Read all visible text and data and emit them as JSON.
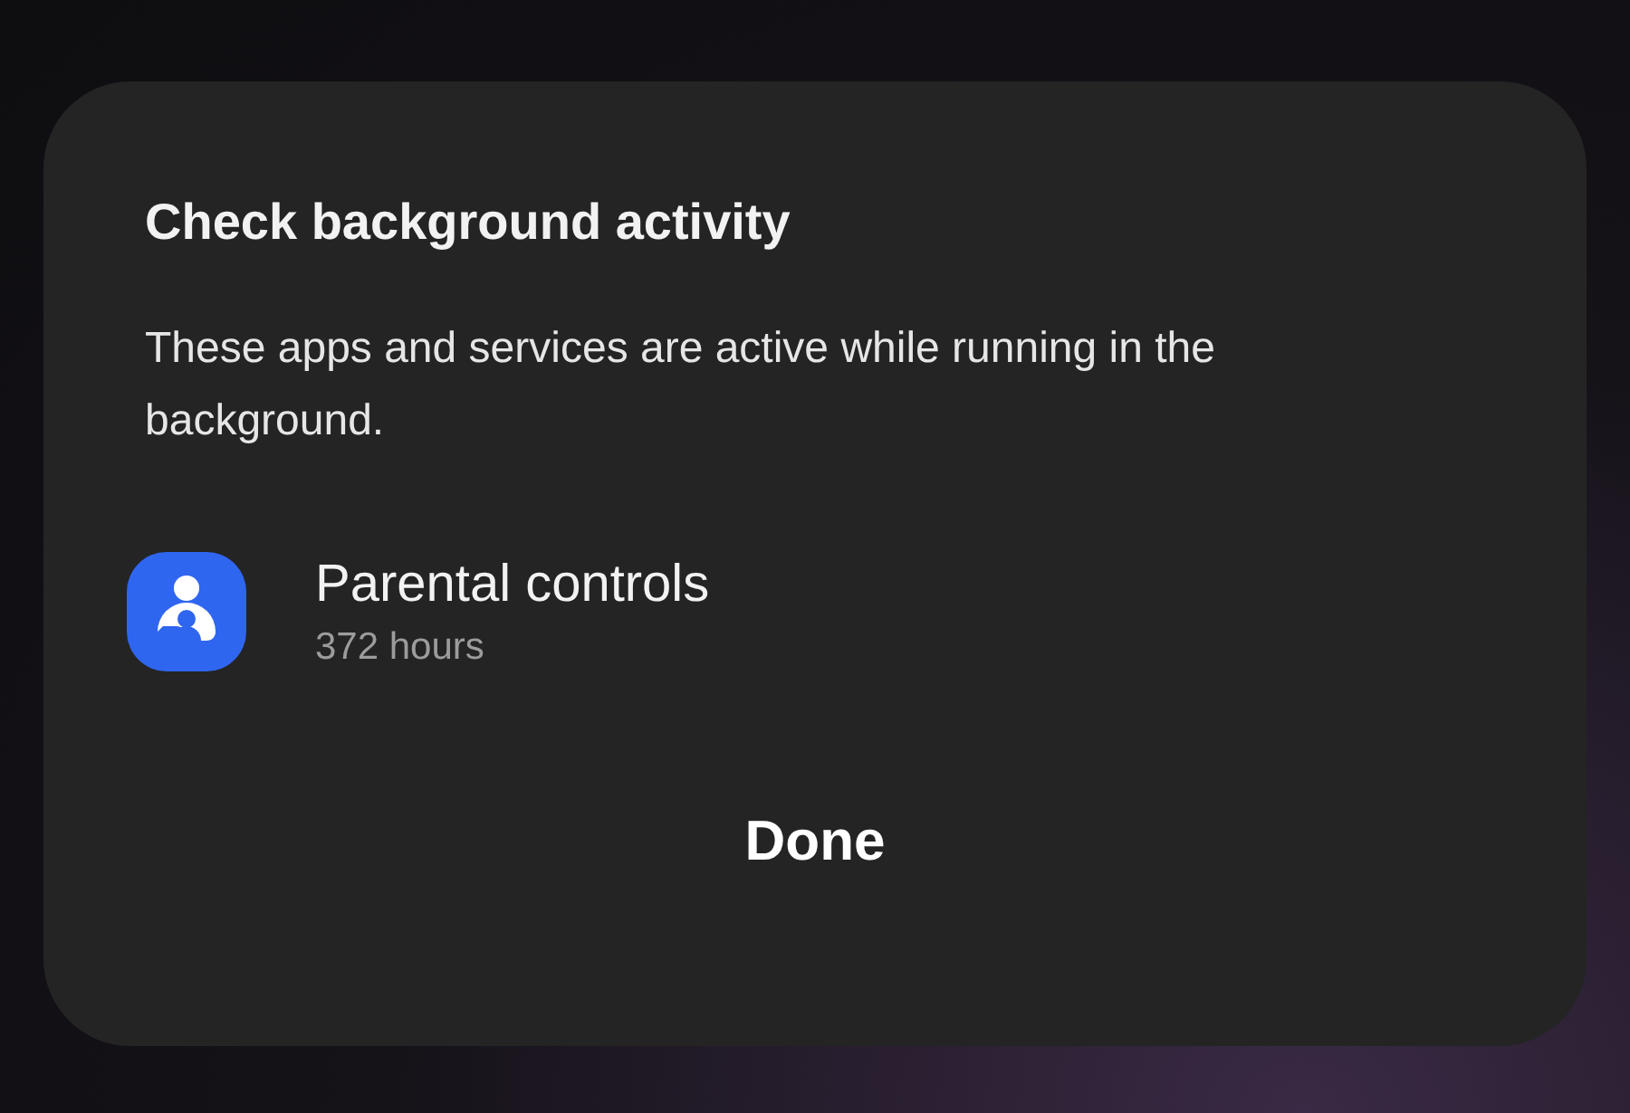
{
  "dialog": {
    "title": "Check background activity",
    "message": "These apps and services are active while running in the background.",
    "apps": [
      {
        "name": "Parental controls",
        "usage": "372 hours"
      }
    ],
    "buttons": [
      "Done"
    ]
  }
}
